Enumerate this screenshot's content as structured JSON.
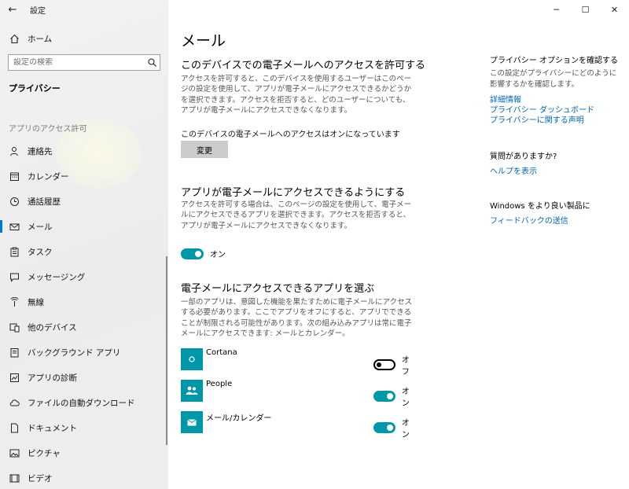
{
  "window": {
    "title": "設定",
    "back_glyph": "←",
    "minimize_glyph": "─",
    "maximize_glyph": "☐",
    "close_glyph": "✕"
  },
  "sidebar": {
    "home_label": "ホーム",
    "search_placeholder": "設定の検索",
    "section_title": "プライバシー",
    "group_label": "アプリのアクセス許可",
    "items": [
      {
        "label": "連絡先",
        "icon": "contacts-icon"
      },
      {
        "label": "カレンダー",
        "icon": "calendar-icon"
      },
      {
        "label": "通話履歴",
        "icon": "call-history-icon"
      },
      {
        "label": "メール",
        "icon": "mail-icon",
        "selected": true
      },
      {
        "label": "タスク",
        "icon": "tasks-icon"
      },
      {
        "label": "メッセージング",
        "icon": "messaging-icon"
      },
      {
        "label": "無線",
        "icon": "radio-icon"
      },
      {
        "label": "他のデバイス",
        "icon": "other-devices-icon"
      },
      {
        "label": "バックグラウンド アプリ",
        "icon": "background-apps-icon"
      },
      {
        "label": "アプリの診断",
        "icon": "app-diagnostics-icon"
      },
      {
        "label": "ファイルの自動ダウンロード",
        "icon": "cloud-icon"
      },
      {
        "label": "ドキュメント",
        "icon": "document-icon"
      },
      {
        "label": "ピクチャ",
        "icon": "pictures-icon"
      },
      {
        "label": "ビデオ",
        "icon": "video-icon"
      }
    ]
  },
  "main": {
    "title": "メール",
    "section1": {
      "heading": "このデバイスでの電子メールへのアクセスを許可する",
      "description": "アクセスを許可すると、このデバイスを使用するユーザーはこのページの設定を使用して、アプリが電子メールにアクセスできるかどうかを選択できます。アクセスを拒否すると、どのユーザーについても、アプリが電子メールにアクセスできなくなります。",
      "status": "このデバイスの電子メールへのアクセスはオンになっています",
      "change_button": "変更"
    },
    "section2": {
      "heading": "アプリが電子メールにアクセスできるようにする",
      "description": "アクセスを許可する場合は、このページの設定を使用して、電子メールにアクセスできるアプリを選択できます。アクセスを拒否すると、アプリが電子メールにアクセスできなくなります。",
      "toggle_state": "オン"
    },
    "section3": {
      "heading": "電子メールにアクセスできるアプリを選ぶ",
      "description": "一部のアプリは、意図した機能を果たすために電子メールにアクセスする必要があります。ここでアプリをオフにすると、アプリでできることが制限される可能性があります。次の組み込みアプリは常に電子メールにアクセスできます: メールとカレンダー。",
      "apps": [
        {
          "name": "Cortana",
          "state": "オフ",
          "on": false,
          "icon": "cortana-icon"
        },
        {
          "name": "People",
          "state": "オン",
          "on": true,
          "icon": "people-icon"
        },
        {
          "name": "メール/カレンダー",
          "state": "オン",
          "on": true,
          "icon": "mail-calendar-icon"
        }
      ]
    }
  },
  "right": {
    "privacy_heading": "プライバシー オプションを確認する",
    "privacy_text": "この設定がプライバシーにどのように影響するかを確認します。",
    "links": [
      "詳細情報",
      "プライバシー ダッシュボード",
      "プライバシーに関する声明"
    ],
    "question_heading": "質問がありますか?",
    "help_link": "ヘルプを表示",
    "feedback_heading": "Windows をより良い製品に",
    "feedback_link": "フィードバックの送信"
  },
  "colors": {
    "accent": "#0097a8",
    "link": "#0066b4",
    "selection_bar": "#0078d7"
  }
}
